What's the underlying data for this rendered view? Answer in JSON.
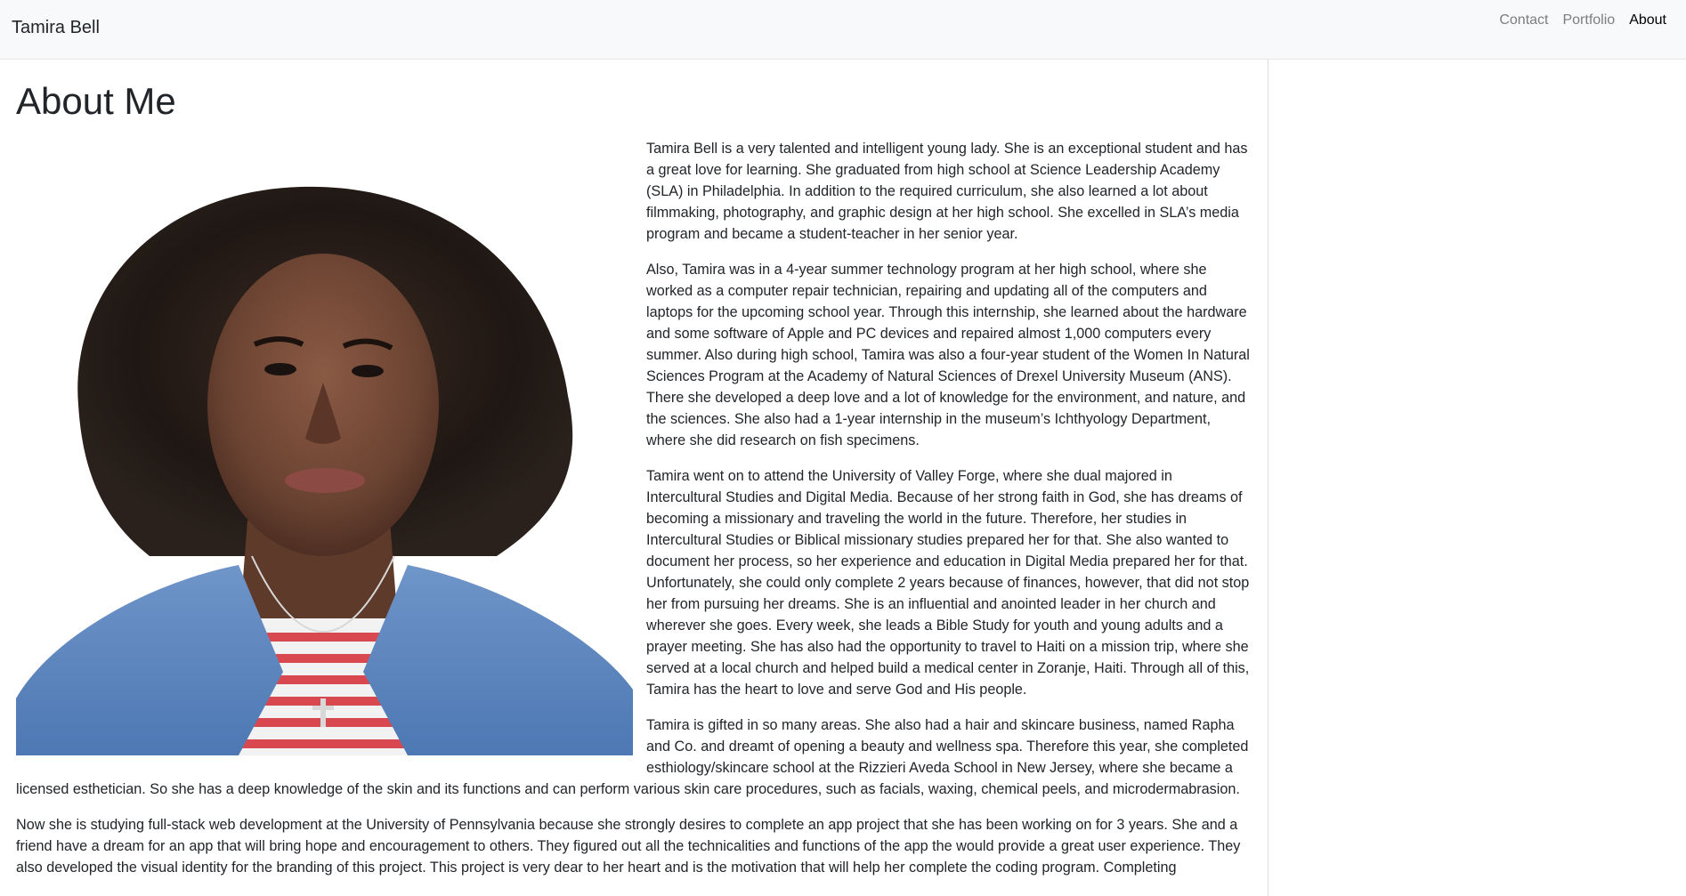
{
  "navbar": {
    "brand": "Tamira Bell",
    "links": [
      {
        "label": "Contact",
        "active": false
      },
      {
        "label": "Portfolio",
        "active": false
      },
      {
        "label": "About",
        "active": true
      }
    ]
  },
  "main": {
    "heading": "About Me",
    "photo_icon": "portrait-photo",
    "paragraphs": [
      "Tamira Bell is a very talented and intelligent young lady. She is an exceptional student and has a great love for learning. She graduated from high school at Science Leadership Academy (SLA) in Philadelphia. In addition to the required curriculum, she also learned a lot about filmmaking, photography, and graphic design at her high school. She excelled in SLA’s media program and became a student-teacher in her senior year.",
      "Also, Tamira was in a 4-year summer technology program at her high school, where she worked as a computer repair technician, repairing and updating all of the computers and laptops for the upcoming school year. Through this internship, she learned about the hardware and some software of Apple and PC devices and repaired almost 1,000 computers every summer. Also during high school, Tamira was also a four-year student of the Women In Natural Sciences Program at the Academy of Natural Sciences of Drexel University Museum (ANS). There she developed a deep love and a lot of knowledge for the environment, and nature, and the sciences. She also had a 1-year internship in the museum’s Ichthyology Department, where she did research on fish specimens.",
      "Tamira went on to attend the University of Valley Forge, where she dual majored in Intercultural Studies and Digital Media. Because of her strong faith in God, she has dreams of becoming a missionary and traveling the world in the future. Therefore, her studies in Intercultural Studies or Biblical missionary studies prepared her for that. She also wanted to document her process, so her experience and education in Digital Media prepared her for that. Unfortunately, she could only complete 2 years because of finances, however, that did not stop her from pursuing her dreams. She is an influential and anointed leader in her church and wherever she goes. Every week, she leads a Bible Study for youth and young adults and a prayer meeting. She has also had the opportunity to travel to Haiti on a mission trip, where she served at a local church and helped build a medical center in Zoranje, Haiti. Through all of this, Tamira has the heart to love and serve God and His people.",
      "Tamira is gifted in so many areas. She also had a hair and skincare business, named Rapha and Co. and dreamt of opening a beauty and wellness spa. Therefore this year, she completed esthiology/skincare school at the Rizzieri Aveda School in New Jersey, where she became a licensed esthetician. So she has a deep knowledge of the skin and its functions and can perform various skin care procedures, such as facials, waxing, chemical peels, and microdermabrasion.",
      "Now she is studying full-stack web development at the University of Pennsylvania because she strongly desires to complete an app project that she has been working on for 3 years. She and a friend have a dream for an app that will bring hope and encouragement to others. They figured out all the technicalities and functions of the app the would provide a great user experience. They also developed the visual identity for the branding of this project. This project is very dear to her heart and is the motivation that will help her complete the coding program. Completing"
    ]
  },
  "colors": {
    "navbar_bg": "#f8f9fa",
    "nav_link": "#7d7d7d",
    "nav_link_active": "#000000",
    "text": "#212529"
  }
}
